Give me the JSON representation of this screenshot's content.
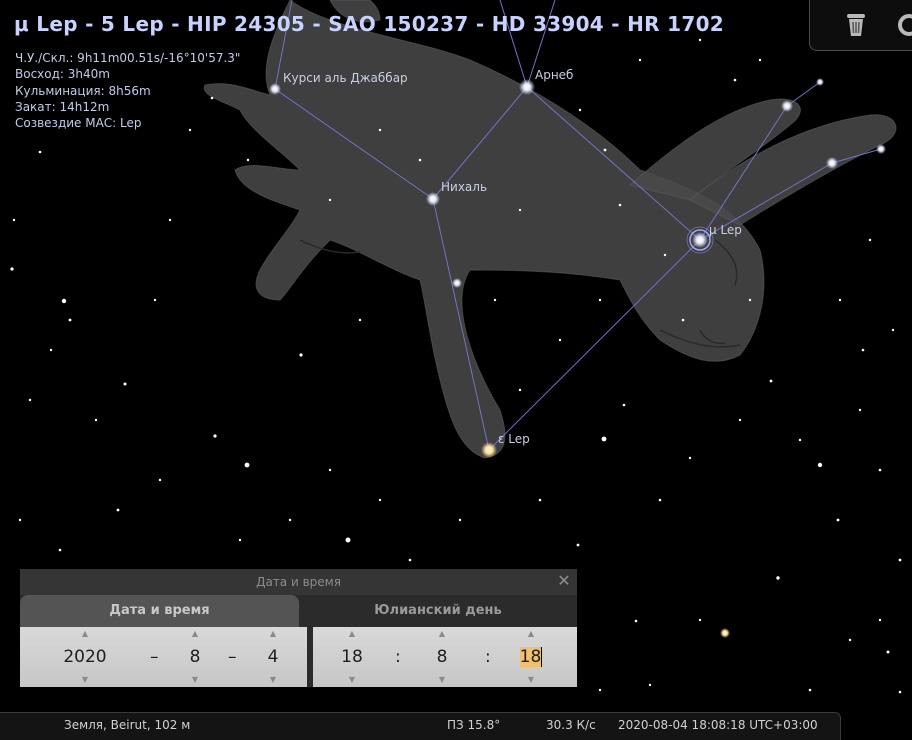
{
  "object_title": "μ Lep - 5 Lep - HIP 24305 - SAO 150237 - HD 33904 - HR 1702",
  "object_info": {
    "coords": "Ч.У./Скл.: 9h11m00.51s/-16°10'57.3\"",
    "rise": "Восход: 3h40m",
    "culmination": "Кульминация: 8h56m",
    "set": "Закат: 14h12m",
    "constellation": "Созвездие МАС: Lep"
  },
  "star_labels": {
    "kursa": "Курси аль Джаббар",
    "arneb": "Арнеб",
    "nihal": "Нихаль",
    "mu_lep": "μ Lep",
    "eps_lep": "ε Lep"
  },
  "icons": {
    "corner": "trash-icon"
  },
  "dialog": {
    "title": "Дата и время",
    "close": "✕",
    "tab_date": "Дата и время",
    "tab_jd": "Юлианский день",
    "year": "2020",
    "month": "8",
    "day": "4",
    "hour": "18",
    "minute": "8",
    "second": "18",
    "date_sep": "–",
    "time_sep": ":"
  },
  "status_bar": {
    "location": "Земля, Beirut, 102 м",
    "fov": "ПЗ 15.8°",
    "fps": "30.3 К/с",
    "datetime": "2020-08-04 18:08:18 UTC+03:00"
  },
  "colors": {
    "title": "#c8d2ff",
    "constellation_lines": "#6f74c8",
    "dialog_bg": "#2b2b2b",
    "highlight": "#f0c06a"
  }
}
